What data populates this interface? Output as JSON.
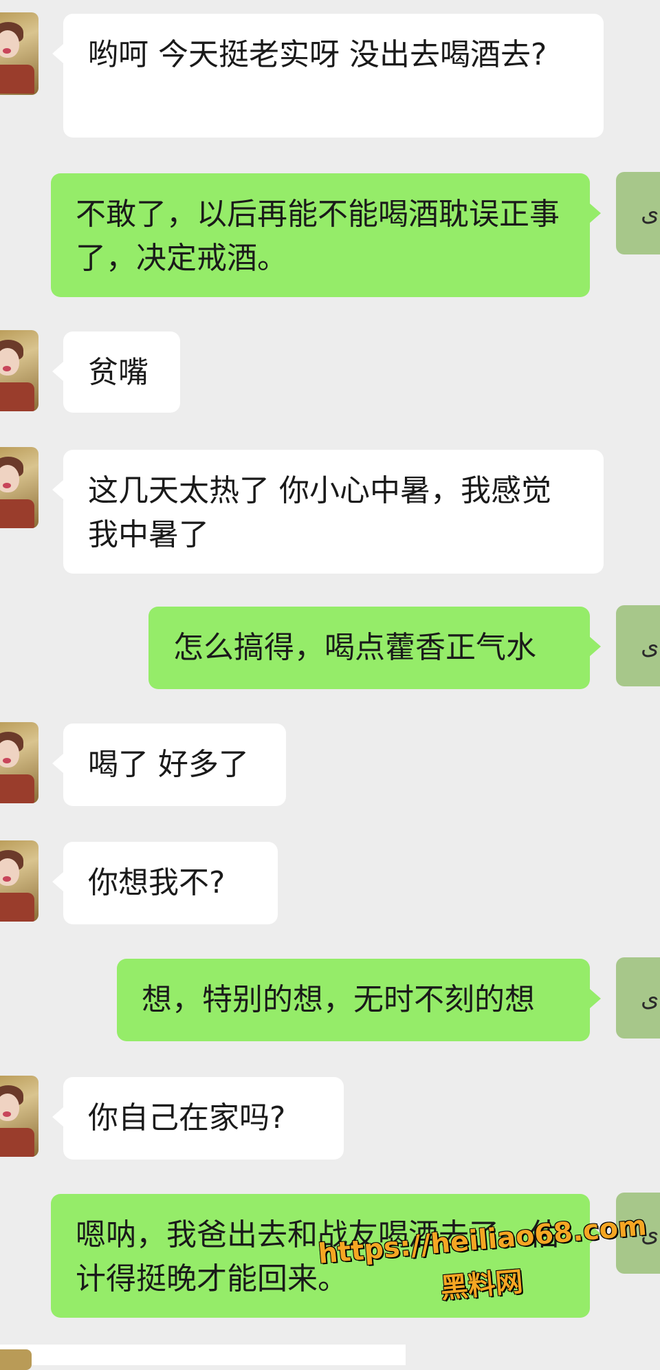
{
  "messages": [
    {
      "side": "in",
      "text": "哟呵 今天挺老实呀 没出去喝酒去?"
    },
    {
      "side": "out",
      "text": "不敢了，以后再能不能喝酒耽误正事了，决定戒酒。"
    },
    {
      "side": "in",
      "text": "贫嘴"
    },
    {
      "side": "in",
      "text": "这几天太热了 你小心中暑，我感觉我中暑了"
    },
    {
      "side": "out",
      "text": "怎么搞得，喝点藿香正气水"
    },
    {
      "side": "in",
      "text": "喝了 好多了"
    },
    {
      "side": "in",
      "text": "你想我不?"
    },
    {
      "side": "out",
      "text": "想，特别的想，无时不刻的想"
    },
    {
      "side": "in",
      "text": "你自己在家吗?"
    },
    {
      "side": "out",
      "text": "嗯呐，我爸出去和战友喝酒去了，估计得挺晚才能回来。"
    }
  ],
  "watermark": {
    "url": "https://heiliao68.com",
    "name": "黑料网"
  },
  "colors": {
    "background": "#ededed",
    "incoming_bubble": "#ffffff",
    "outgoing_bubble": "#95ec69",
    "watermark": "#f5a623"
  },
  "icons": {
    "contact_avatar": "contact-avatar-icon",
    "self_avatar": "self-avatar-icon"
  },
  "self_avatar_glyph": "ى"
}
